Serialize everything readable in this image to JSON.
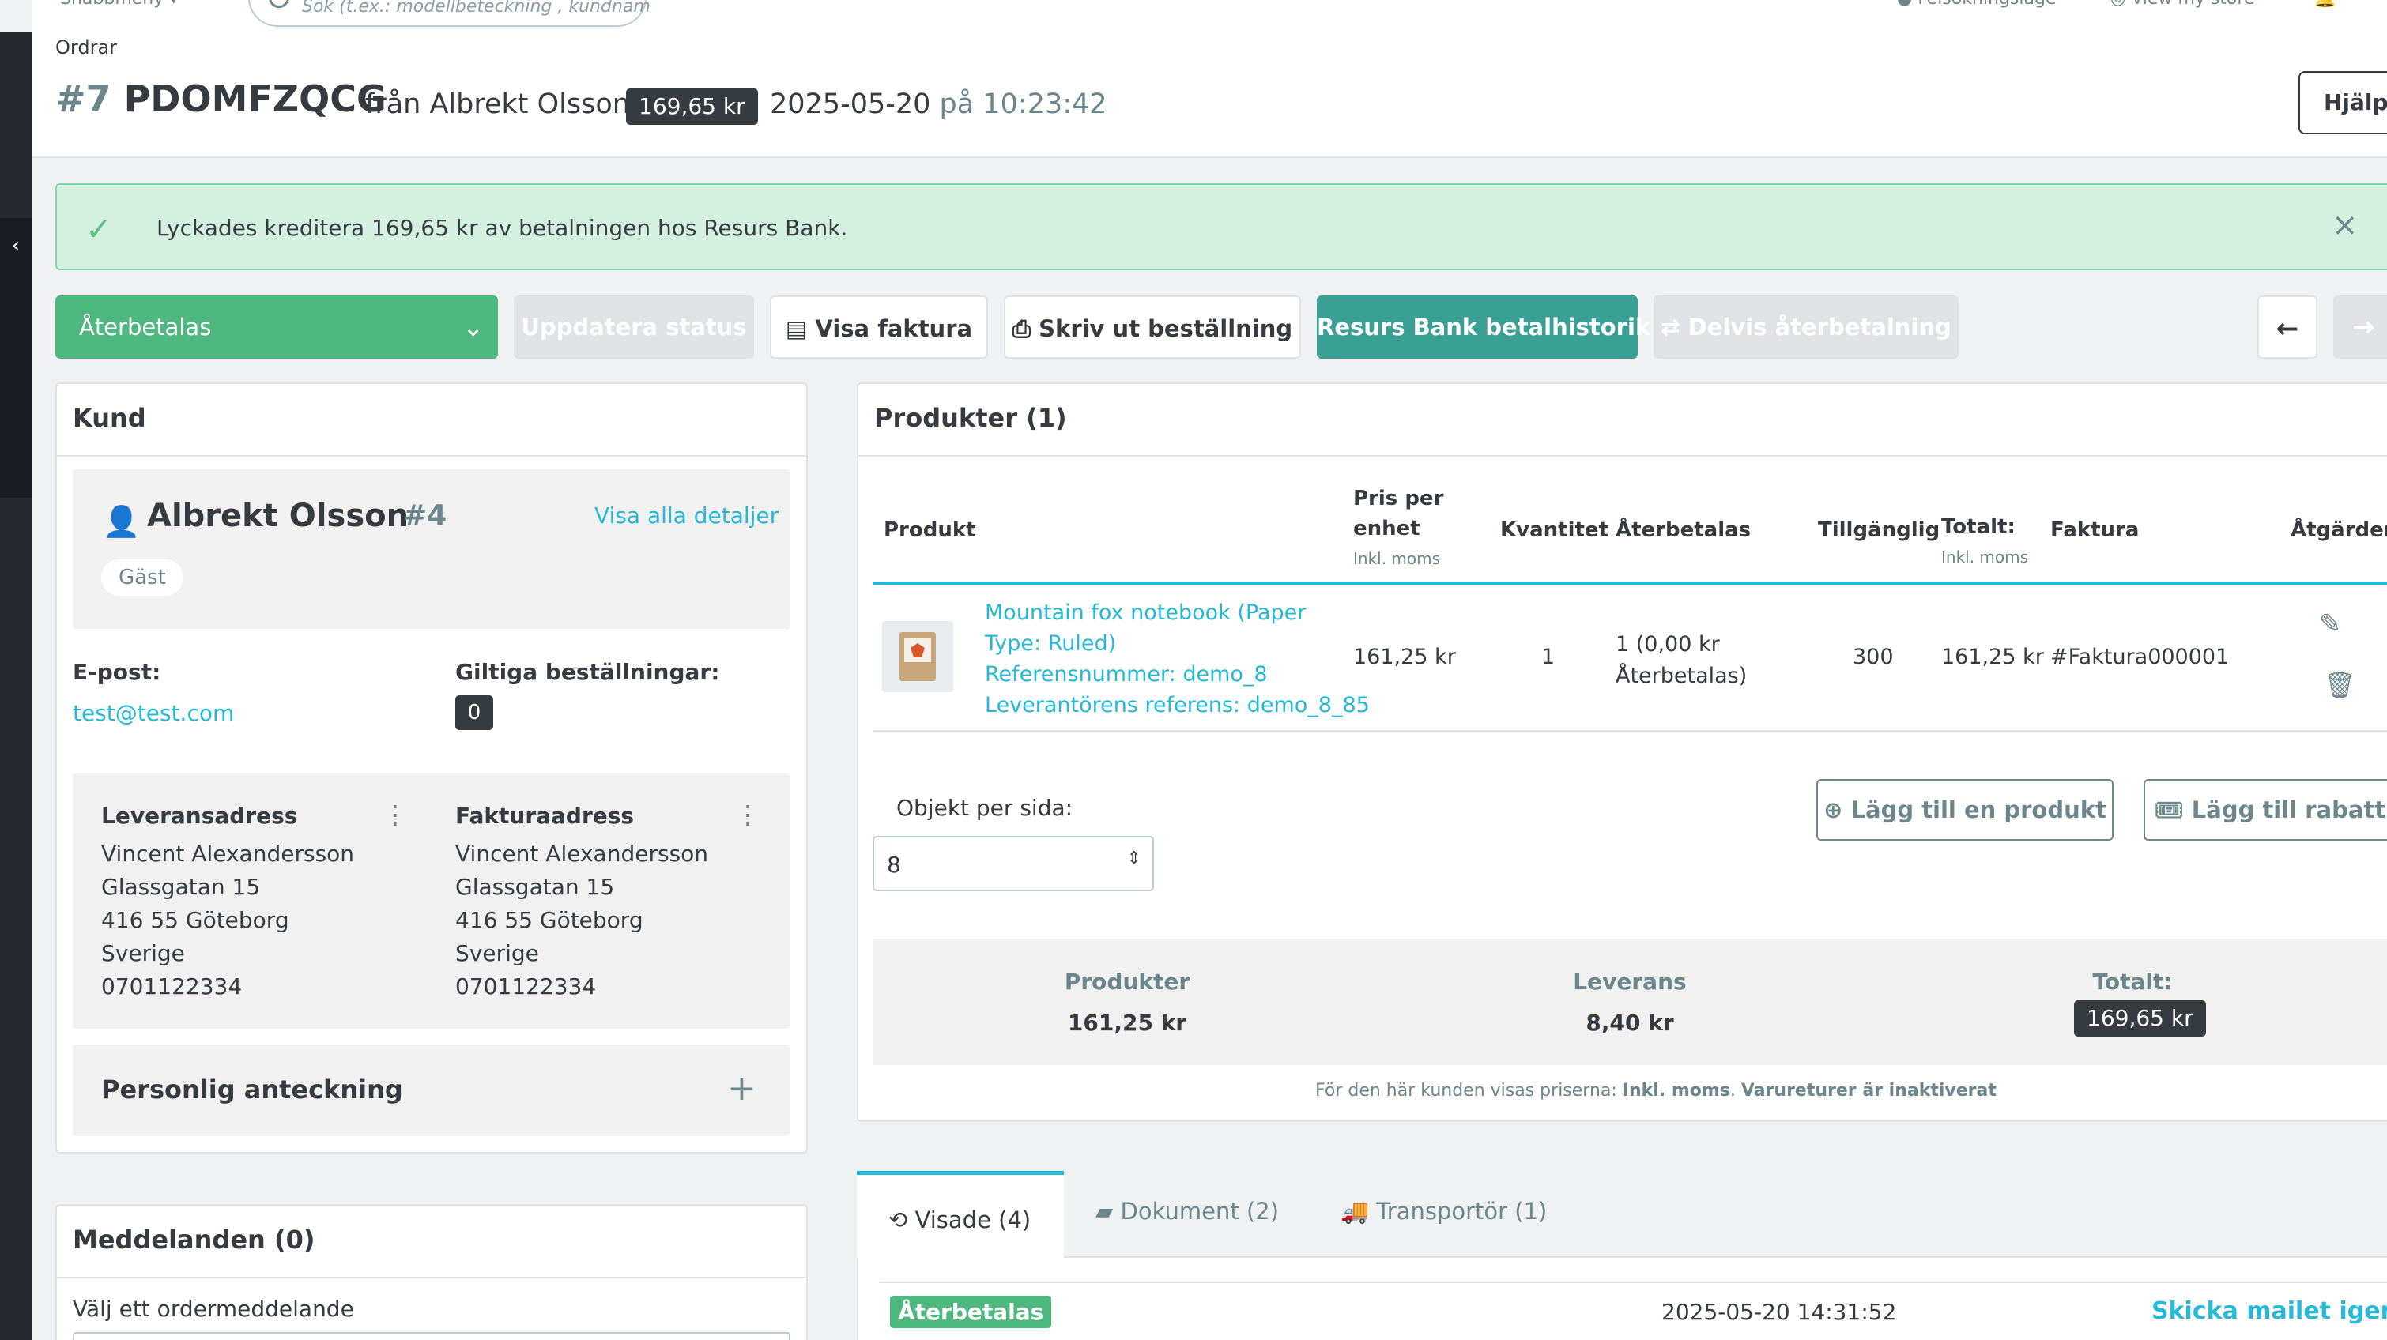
{
  "topbar": {
    "cut_left": "Snabbmeny",
    "search_placeholder": "Sök (t.ex.: modellbeteckning , kundnam",
    "cut_right_1": "Felsökningsläge",
    "cut_right_2": "View my store"
  },
  "breadcrumb": "Ordrar",
  "order": {
    "number": "#7",
    "reference": "PDOMFZQCG",
    "from": "från Albrekt Olsson",
    "total_badge": "169,65 kr",
    "date": "2025-05-20",
    "date_sep": "på",
    "time": "10:23:42"
  },
  "help_label": "Hjälp",
  "alert": {
    "message": "Lyckades kreditera 169,65 kr av betalningen hos Resurs Bank."
  },
  "actions": {
    "status_value": "Återbetalas",
    "update_status": "Uppdatera status",
    "view_invoice": "Visa faktura",
    "print_order": "Skriv ut beställning",
    "resurs_history": "Resurs Bank betalhistorik",
    "partial_refund": "Delvis återbetalning"
  },
  "customer": {
    "card_title": "Kund",
    "name": "Albrekt Olsson",
    "id": "#4",
    "view_all": "Visa alla detaljer",
    "guest": "Gäst",
    "email_label": "E-post:",
    "email": "test@test.com",
    "valid_orders_label": "Giltiga beställningar:",
    "valid_orders": "0",
    "shipping_label": "Leveransadress",
    "invoice_label": "Fakturaadress",
    "shipping_address": [
      "Vincent Alexandersson",
      "Glassgatan 15",
      "416 55 Göteborg",
      "Sverige",
      "0701122334"
    ],
    "invoice_address": [
      "Vincent Alexandersson",
      "Glassgatan 15",
      "416 55 Göteborg",
      "Sverige",
      "0701122334"
    ],
    "note_label": "Personlig anteckning"
  },
  "messages": {
    "title": "Meddelanden (0)",
    "select_label": "Välj ett ordermeddelande"
  },
  "products": {
    "title": "Produkter (1)",
    "headers": {
      "product": "Produkt",
      "unit_price_1": "Pris per",
      "unit_price_2": "enhet",
      "unit_price_sub": "Inkl. moms",
      "quantity": "Kvantitet",
      "refunded": "Återbetalas",
      "available": "Tillgänglig",
      "total": "Totalt:",
      "total_sub": "Inkl. moms",
      "invoice": "Faktura",
      "actions": "Åtgärder"
    },
    "row": {
      "name_1": "Mountain fox notebook (Paper",
      "name_2": "Type: Ruled)",
      "ref": "Referensnummer: demo_8",
      "supplier_ref": "Leverantörens referens: demo_8_85",
      "unit_price": "161,25 kr",
      "quantity": "1",
      "refunded_1": "1 (0,00 kr",
      "refunded_2": "Återbetalas)",
      "available": "300",
      "total": "161,25 kr",
      "invoice": "#Faktura000001"
    },
    "per_page_label": "Objekt per sida:",
    "per_page_value": "8",
    "add_product": "Lägg till en produkt",
    "add_discount": "Lägg till rabatt",
    "summary": {
      "products_label": "Produkter",
      "products_value": "161,25 kr",
      "shipping_label": "Leverans",
      "shipping_value": "8,40 kr",
      "total_label": "Totalt:",
      "total_value": "169,65 kr"
    },
    "price_note_prefix": "För den här kunden visas priserna:",
    "price_note_tax": "Inkl. moms",
    "price_note_returns": "Varureturer är inaktiverat"
  },
  "history_tabs": {
    "viewed": "Visade (4)",
    "documents": "Dokument (2)",
    "carrier": "Transportör (1)"
  },
  "history_row": {
    "status": "Återbetalas",
    "datetime": "2025-05-20 14:31:52",
    "resend": "Skicka mailet igen"
  },
  "colors": {
    "success_bg": "#d4f0de",
    "status_green": "#4fb87f",
    "teal": "#3a9f94",
    "link": "#25b9d7",
    "dark": "#363a41"
  }
}
